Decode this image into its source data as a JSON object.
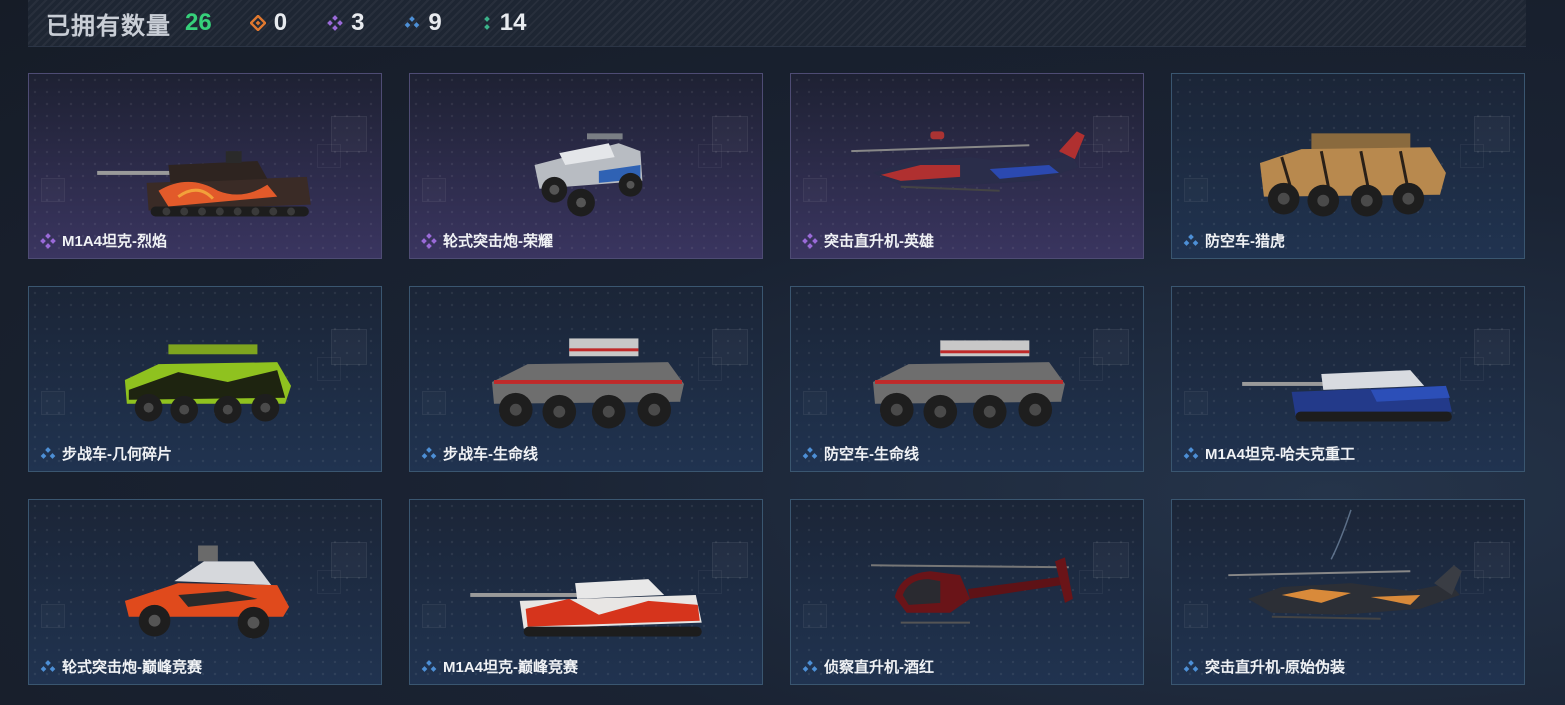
{
  "header": {
    "owned_label": "已拥有数量",
    "owned_total": "26",
    "rarity_counts": [
      {
        "icon": "orange-diamond-icon",
        "value": "0",
        "color": "#e0782f"
      },
      {
        "icon": "purple-diamond-icon",
        "value": "3",
        "color": "#9a6ad8"
      },
      {
        "icon": "blue-diamond-icon",
        "value": "9",
        "color": "#4d8fd6"
      },
      {
        "icon": "green-dots-icon",
        "value": "14",
        "color": "#3bb38a"
      }
    ]
  },
  "colors": {
    "epic": "#9a6ad8",
    "rare": "#4d8fd6",
    "owned_count": "#36d07a"
  },
  "cards": [
    {
      "name": "M1A4坦克-烈焰",
      "rarity": "epic",
      "vehicle": "tank"
    },
    {
      "name": "轮式突击炮-荣耀",
      "rarity": "epic",
      "vehicle": "buggy"
    },
    {
      "name": "突击直升机-英雄",
      "rarity": "epic",
      "vehicle": "attack-helicopter"
    },
    {
      "name": "防空车-猎虎",
      "rarity": "rare",
      "vehicle": "apc"
    },
    {
      "name": "步战车-几何碎片",
      "rarity": "rare",
      "vehicle": "apc"
    },
    {
      "name": "步战车-生命线",
      "rarity": "rare",
      "vehicle": "apc"
    },
    {
      "name": "防空车-生命线",
      "rarity": "rare",
      "vehicle": "apc"
    },
    {
      "name": "M1A4坦克-哈夫克重工",
      "rarity": "rare",
      "vehicle": "tank"
    },
    {
      "name": "轮式突击炮-巅峰竞赛",
      "rarity": "rare",
      "vehicle": "buggy"
    },
    {
      "name": "M1A4坦克-巅峰竞赛",
      "rarity": "rare",
      "vehicle": "tank"
    },
    {
      "name": "侦察直升机-酒红",
      "rarity": "rare",
      "vehicle": "scout-helicopter"
    },
    {
      "name": "突击直升机-原始伪装",
      "rarity": "rare",
      "vehicle": "attack-helicopter"
    }
  ]
}
